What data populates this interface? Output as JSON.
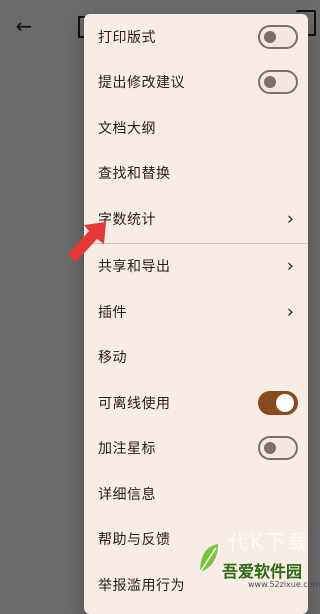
{
  "menu": {
    "items": [
      {
        "label": "打印版式",
        "control": "toggle",
        "state": "off"
      },
      {
        "label": "提出修改建议",
        "control": "toggle",
        "state": "off"
      },
      {
        "label": "文档大纲"
      },
      {
        "label": "查找和替换"
      },
      {
        "label": "字数统计",
        "control": "chevron"
      },
      {
        "label": "共享和导出",
        "control": "chevron"
      },
      {
        "label": "插件",
        "control": "chevron"
      },
      {
        "label": "移动"
      },
      {
        "label": "可离线使用",
        "control": "toggle",
        "state": "on"
      },
      {
        "label": "加注星标",
        "control": "toggle",
        "state": "off"
      },
      {
        "label": "详细信息"
      },
      {
        "label": "帮助与反馈"
      },
      {
        "label": "举报滥用行为"
      }
    ]
  },
  "watermark": {
    "top": "代K下载",
    "main": "吾爱软件园",
    "url": "www.52zixue.com"
  },
  "colors": {
    "menu_bg": "#f7ece6",
    "toggle_on": "#8a4a1d",
    "pointer": "#e53935"
  }
}
